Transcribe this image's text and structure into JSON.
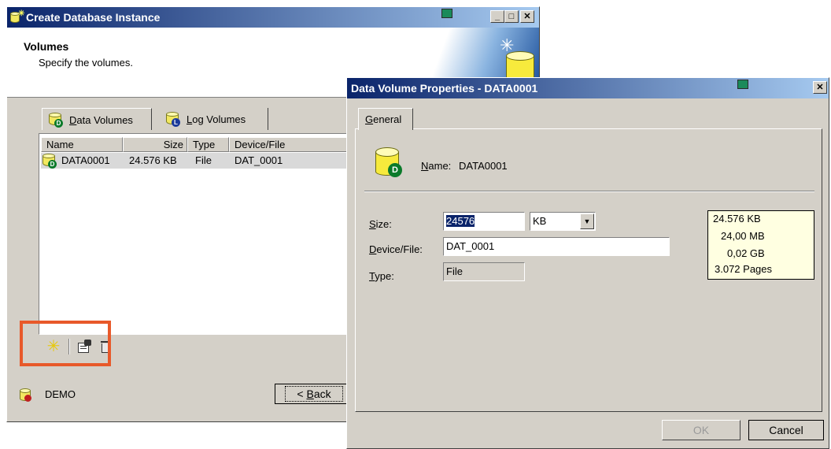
{
  "wizard": {
    "title": "Create Database Instance",
    "header_title": "Volumes",
    "header_subtitle": "Specify the volumes.",
    "tabs": [
      {
        "label": "Data Volumes",
        "underline": "D",
        "rest": "ata Volumes",
        "icon": "data-volume-icon"
      },
      {
        "label": "Log Volumes",
        "underline": "L",
        "rest": "og Volumes",
        "icon": "log-volume-icon"
      }
    ],
    "columns": [
      "Name",
      "Size",
      "Type",
      "Device/File"
    ],
    "rows": [
      {
        "name": "DATA0001",
        "size": "24.576 KB",
        "type": "File",
        "device": "DAT_0001"
      }
    ],
    "toolbar": [
      "new-volume-icon",
      "properties-icon",
      "delete-icon"
    ],
    "instance_name": "DEMO",
    "back_button": "< Back",
    "back_underline": "B",
    "highlight_color": "#e8592a"
  },
  "dialog": {
    "title": "Data Volume Properties - DATA0001",
    "tab_general": "General",
    "tab_general_underline": "G",
    "tab_general_rest": "eneral",
    "name_label": "Name:",
    "name_underline": "N",
    "name_label_rest": "ame:",
    "name_value": "DATA0001",
    "size_label": "Size:",
    "size_underline": "S",
    "size_label_rest": "ize:",
    "size_value": "24576",
    "size_unit": "KB",
    "device_label": "Device/File:",
    "device_underline": "D",
    "device_label_rest": "evice/File:",
    "device_value": "DAT_0001",
    "type_label": "Type:",
    "type_underline": "T",
    "type_label_rest": "ype:",
    "type_value": "File",
    "info": [
      "24.576 KB",
      "24,00 MB",
      "0,02 GB",
      "3.072 Pages"
    ],
    "ok_button": "OK",
    "cancel_button": "Cancel",
    "icon_badge": "D",
    "info_bg": "#ffffe1"
  }
}
